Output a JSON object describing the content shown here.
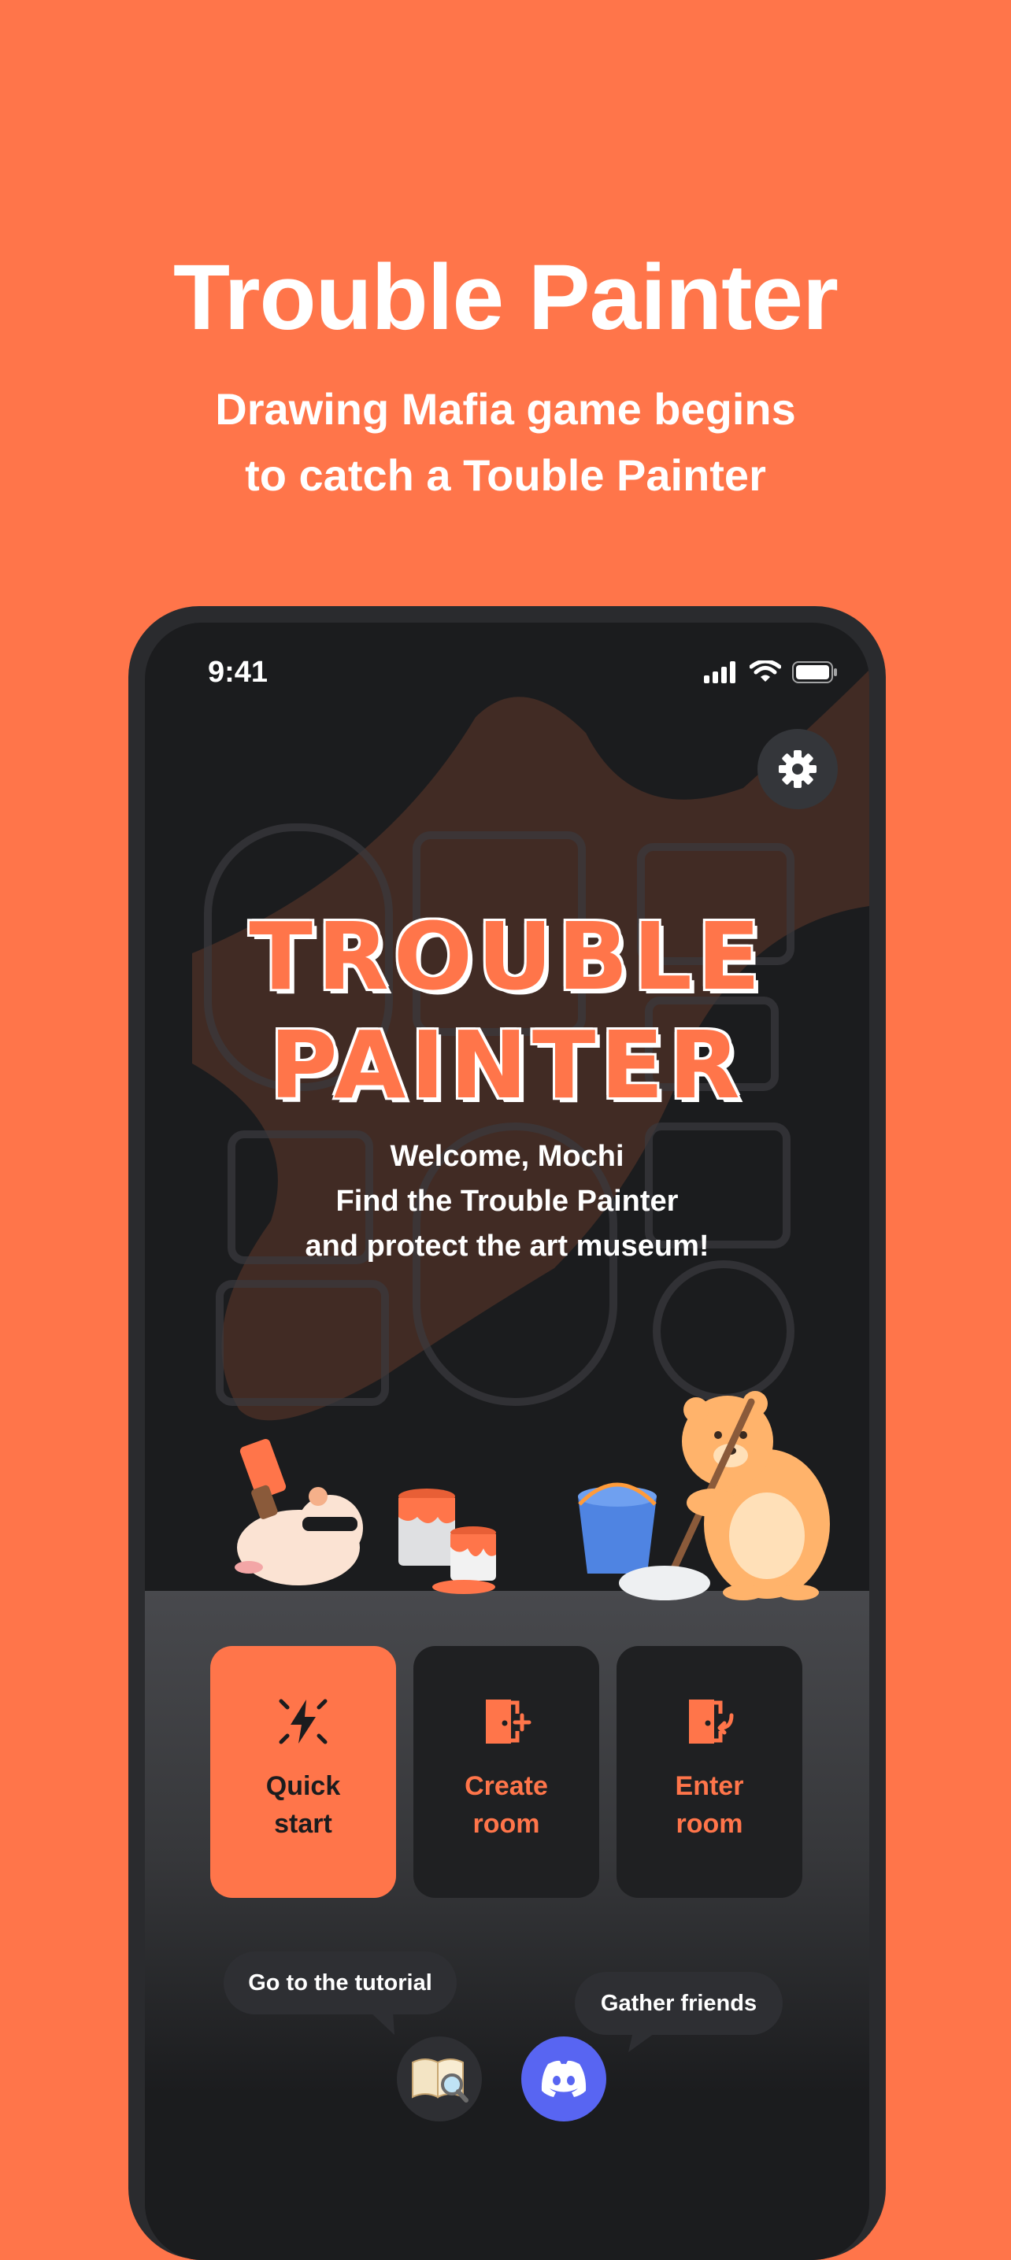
{
  "promo": {
    "title": "Trouble Painter",
    "subtitle_line1": "Drawing Mafia game begins",
    "subtitle_line2": "to catch a Touble Painter"
  },
  "status_bar": {
    "time": "9:41",
    "icons": [
      "cellular-signal-icon",
      "wifi-icon",
      "battery-icon"
    ]
  },
  "settings": {
    "icon": "gear-icon"
  },
  "logo": {
    "line1": "TROUBLE",
    "line2": "PAINTER"
  },
  "welcome": {
    "line1": "Welcome, Mochi",
    "line2": "Find the Trouble Painter",
    "line3": "and protect the art museum!"
  },
  "actions": {
    "quick_start": {
      "line1": "Quick",
      "line2": "start",
      "icon": "lightning-icon"
    },
    "create_room": {
      "line1": "Create",
      "line2": "room",
      "icon": "door-plus-icon"
    },
    "enter_room": {
      "line1": "Enter",
      "line2": "room",
      "icon": "door-enter-icon"
    }
  },
  "bottom": {
    "tutorial_label": "Go to the tutorial",
    "friends_label": "Gather friends",
    "tutorial_icon": "book-magnifier-icon",
    "discord_icon": "discord-icon"
  },
  "colors": {
    "accent": "#ff754a",
    "screen_bg": "#1b1c1e",
    "card_bg": "#1f2022",
    "discord": "#5865f2"
  }
}
